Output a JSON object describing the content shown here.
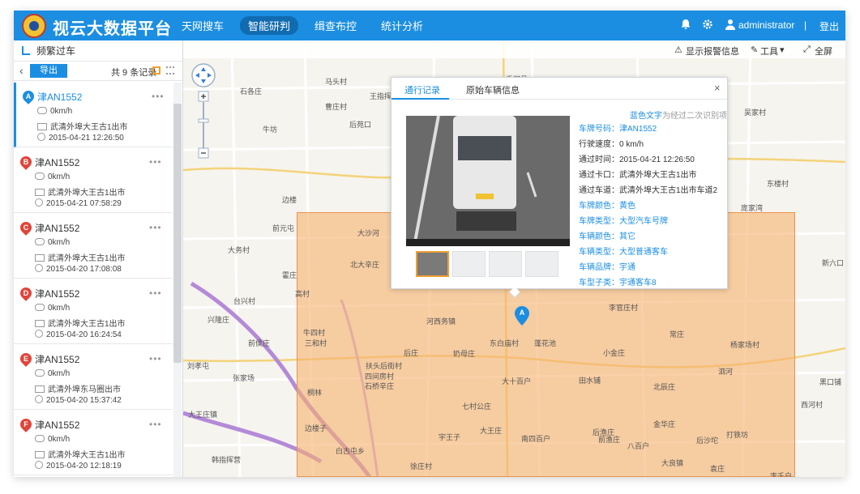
{
  "app": {
    "title": "视云大数据平台"
  },
  "nav": [
    "天网搜车",
    "智能研判",
    "缉查布控",
    "统计分析"
  ],
  "header": {
    "user": "administrator",
    "separator": "|",
    "logout": "登出"
  },
  "panel": {
    "title": "频繁过车",
    "export": "导出",
    "count": "共 9 条记录",
    "records": [
      {
        "marker": "A",
        "plate": "津AN1552",
        "speed": "0km/h",
        "location": "武清外埠大王古1出市",
        "time": "2015-04-21 12:26:50"
      },
      {
        "marker": "B",
        "plate": "津AN1552",
        "speed": "0km/h",
        "location": "武清外埠大王古1出市",
        "time": "2015-04-21 07:58:29"
      },
      {
        "marker": "C",
        "plate": "津AN1552",
        "speed": "0km/h",
        "location": "武清外埠大王古1出市",
        "time": "2015-04-20 17:08:08"
      },
      {
        "marker": "D",
        "plate": "津AN1552",
        "speed": "0km/h",
        "location": "武清外埠大王古1出市",
        "time": "2015-04-20 16:24:54"
      },
      {
        "marker": "E",
        "plate": "津AN1552",
        "speed": "0km/h",
        "location": "武清外埠东马圈出市",
        "time": "2015-04-20 15:37:42"
      },
      {
        "marker": "F",
        "plate": "津AN1552",
        "speed": "0km/h",
        "location": "武清外埠大王古1出市",
        "time": "2015-04-20 12:18:19"
      }
    ]
  },
  "toolbar": {
    "alarm": "显示报警信息",
    "tools": "工具",
    "fullscreen": "全屏"
  },
  "popup": {
    "tabs": [
      "通行记录",
      "原始车辆信息"
    ],
    "close": "×",
    "hint_blue": "蓝色文字",
    "hint_rest": "为经过二次识别项",
    "fields": [
      {
        "text": "车牌号码：津AN1552",
        "blue": true
      },
      {
        "text": "行驶速度：0 km/h",
        "blue": false
      },
      {
        "text": "通过时间：2015-04-21 12:26:50",
        "blue": false
      },
      {
        "text": "通过卡口：武清外埠大王古1出市",
        "blue": false
      },
      {
        "text": "通过车道：武清外埠大王古1出市车道2",
        "blue": false
      },
      {
        "text": "车牌颜色：黄色",
        "blue": true
      },
      {
        "text": "车牌类型：大型汽车号牌",
        "blue": true
      },
      {
        "text": "车辆颜色：其它",
        "blue": true
      },
      {
        "text": "车辆类型：大型普通客车",
        "blue": true
      },
      {
        "text": "车辆品牌：宇通",
        "blue": true
      },
      {
        "text": "车型子类：宇通客车8",
        "blue": true
      }
    ]
  },
  "map": {
    "marker": "A",
    "labels": [
      "马头村",
      "石各庄",
      "香河县",
      "王指挥庄",
      "后苑口",
      "牛坊",
      "吴家村",
      "曹庄村",
      "边楼",
      "高村",
      "大沙河",
      "前元屯",
      "大务村",
      "北大辛庄",
      "台兴村",
      "霍庄",
      "牛四村",
      "河西务镇",
      "东白庙村",
      "蓬花池",
      "后庄",
      "奶母庄",
      "小金庄",
      "杨家场村",
      "大十百户",
      "田水铺",
      "北辰庄",
      "七村公庄",
      "大王庄",
      "南四百户",
      "后渔庄",
      "前渔庄",
      "后沙坨",
      "金华庄",
      "打铁坊",
      "大良镇",
      "袁庄",
      "李千户",
      "徐庄村",
      "大王庄镇",
      "白古屯乡",
      "韩指挥营",
      "桐林",
      "张家场",
      "扶头后街村",
      "四间房村",
      "石桥辛庄",
      "前侯庄",
      "刘孝屯",
      "八百户",
      "李官庄村",
      "庞家湾",
      "边楼子",
      "宇王子",
      "兴隆庄",
      "三和村",
      "新六口",
      "东楼村",
      "常庄",
      "泗河",
      "黑口铺",
      "西河村"
    ]
  }
}
